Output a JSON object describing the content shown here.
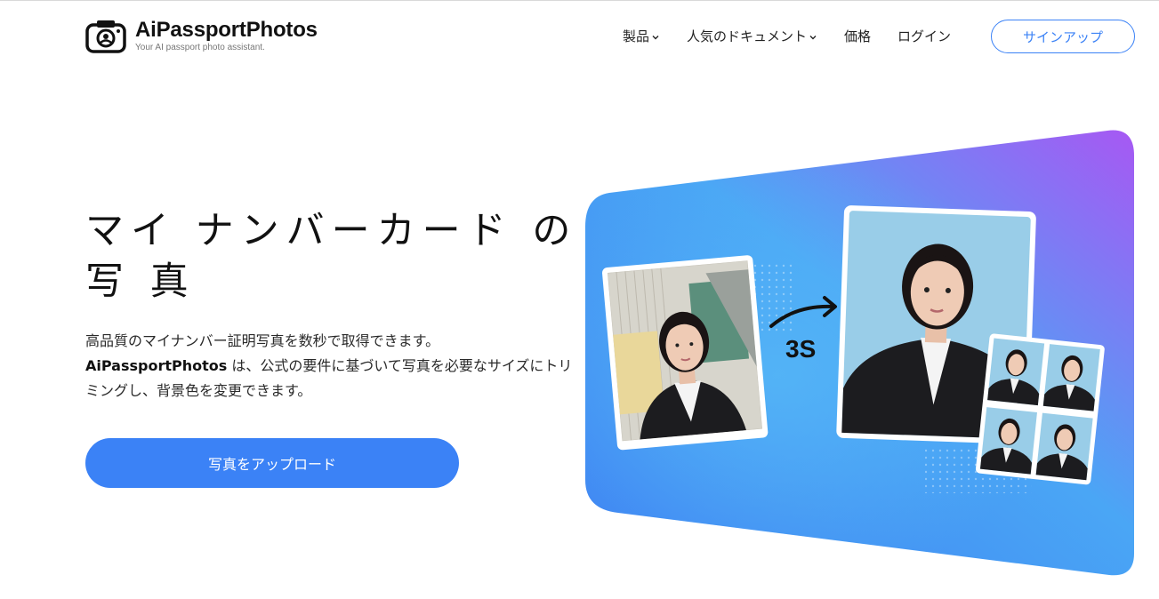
{
  "brand": {
    "name": "AiPassportPhotos",
    "tagline": "Your AI passport photo assistant."
  },
  "nav": {
    "items": [
      {
        "label": "製品",
        "has_dropdown": true
      },
      {
        "label": "人気のドキュメント",
        "has_dropdown": true
      },
      {
        "label": "価格",
        "has_dropdown": false
      },
      {
        "label": "ログイン",
        "has_dropdown": false
      }
    ],
    "signup_label": "サインアップ"
  },
  "hero": {
    "title": "マイ ナンバーカード の 写 真",
    "desc_line1": "高品質のマイナンバー証明写真を数秒で取得できます。",
    "desc_brand": "AiPassportPhotos",
    "desc_line2_rest": " は、公式の要件に基づいて写真を必要なサイズにトリミングし、背景色を変更できます。",
    "upload_label": "写真をアップロード"
  },
  "visual": {
    "speed_label": "3S"
  },
  "colors": {
    "accent": "#3b82f6",
    "gradient_start": "#3b82f6",
    "gradient_end": "#a855f7",
    "photo_bg": "#99cde8"
  }
}
